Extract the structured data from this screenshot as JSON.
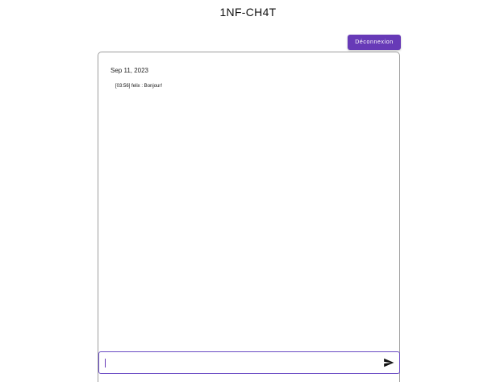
{
  "header": {
    "title": "1NF-CH4T",
    "logout_label": "Déconnexion"
  },
  "chat": {
    "date": "Sep 11, 2023",
    "messages": [
      {
        "text": "[03:56] felix : Bonjour!"
      }
    ]
  },
  "composer": {
    "value": "",
    "placeholder": "",
    "send_icon": "send-icon"
  },
  "colors": {
    "accent": "#673ab7",
    "border": "#9e9e9e"
  }
}
